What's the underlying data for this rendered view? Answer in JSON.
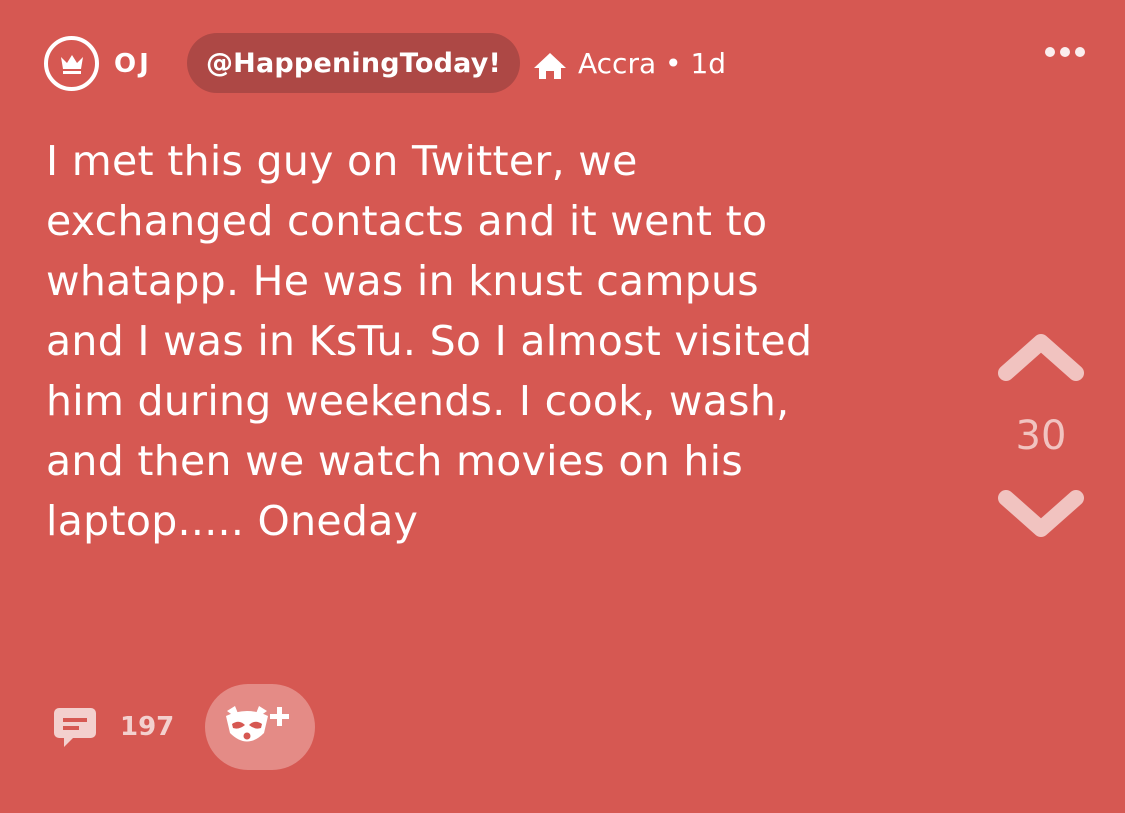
{
  "header": {
    "username": "OJ",
    "channel": "@HappeningToday!",
    "location": "Accra",
    "separator": "•",
    "age": "1d",
    "location_line": "Accra • 1d"
  },
  "post": {
    "text": "I met this guy on Twitter, we\nexchanged contacts and it went to\nwhatapp. He was in knust campus\nand I was in KsTu. So I almost visited\nhim during weekends. I cook, wash,\nand then we watch movies on his\nlaptop..... Oneday"
  },
  "votes": {
    "count": "30"
  },
  "footer": {
    "comment_count": "197"
  },
  "icons": {
    "avatar": "crown-icon",
    "location": "home-icon",
    "more": "more-dots-icon",
    "upvote": "chevron-up-icon",
    "downvote": "chevron-down-icon",
    "comment": "comment-icon",
    "mascot": "raccoon-plus-icon"
  },
  "colors": {
    "background": "#d65852",
    "tag_background": "#ad4845",
    "vote_muted": "#f1c3c0",
    "mascot_button": "#e48b86"
  }
}
